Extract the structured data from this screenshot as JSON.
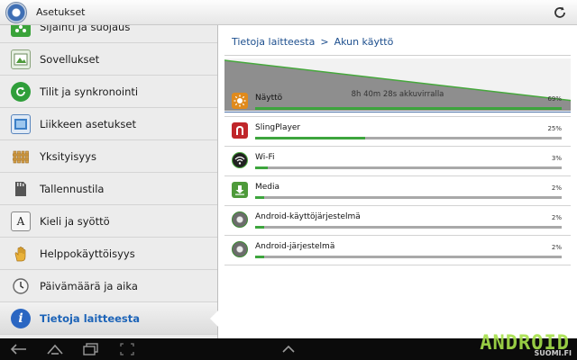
{
  "app": {
    "title": "Asetukset"
  },
  "sidebar": {
    "items": [
      {
        "label": "Sijainti ja suojaus",
        "icon": "location-security-icon",
        "color": "#3aa33a"
      },
      {
        "label": "Sovellukset",
        "icon": "applications-icon",
        "color": "#4e9a3a"
      },
      {
        "label": "Tilit ja synkronointi",
        "icon": "sync-icon",
        "color": "#2f9e3a"
      },
      {
        "label": "Liikkeen asetukset",
        "icon": "motion-icon",
        "color": "#3b7fc7"
      },
      {
        "label": "Yksityisyys",
        "icon": "privacy-fence-icon",
        "color": "#d8a24a"
      },
      {
        "label": "Tallennustila",
        "icon": "storage-icon",
        "color": "#555555"
      },
      {
        "label": "Kieli ja syöttö",
        "icon": "language-icon",
        "color": "#eeeeee"
      },
      {
        "label": "Helppokäyttöisyys",
        "icon": "hand-icon",
        "color": "#e9b23a"
      },
      {
        "label": "Päivämäärä ja aika",
        "icon": "clock-icon",
        "color": "#cccccc"
      },
      {
        "label": "Tietoja laitteesta",
        "icon": "info-icon",
        "color": "#2a66c2"
      }
    ]
  },
  "breadcrumb": {
    "parent": "Tietoja laitteesta",
    "separator": ">",
    "current": "Akun käyttö"
  },
  "battery": {
    "summary": "8h 40m 28s akkuvirralla",
    "remaining_level": 0.6
  },
  "usage": [
    {
      "name": "Näyttö",
      "percent_label": "69%",
      "fraction": 1.0,
      "icon": "brightness-icon",
      "color": "#e08a1c"
    },
    {
      "name": "SlingPlayer",
      "percent_label": "25%",
      "fraction": 0.36,
      "icon": "slingplayer-icon",
      "color": "#c0262a"
    },
    {
      "name": "Wi-Fi",
      "percent_label": "3%",
      "fraction": 0.04,
      "icon": "wifi-icon",
      "color": "#222222"
    },
    {
      "name": "Media",
      "percent_label": "2%",
      "fraction": 0.03,
      "icon": "download-icon",
      "color": "#4e9a3a"
    },
    {
      "name": "Android-käyttöjärjestelmä",
      "percent_label": "2%",
      "fraction": 0.03,
      "icon": "android-os-icon",
      "color": "#9a9a9a"
    },
    {
      "name": "Android-järjestelmä",
      "percent_label": "2%",
      "fraction": 0.03,
      "icon": "android-system-icon",
      "color": "#9a9a9a"
    }
  ],
  "watermark": {
    "logo": "ANDROID",
    "site": "SUOMI.FI"
  }
}
